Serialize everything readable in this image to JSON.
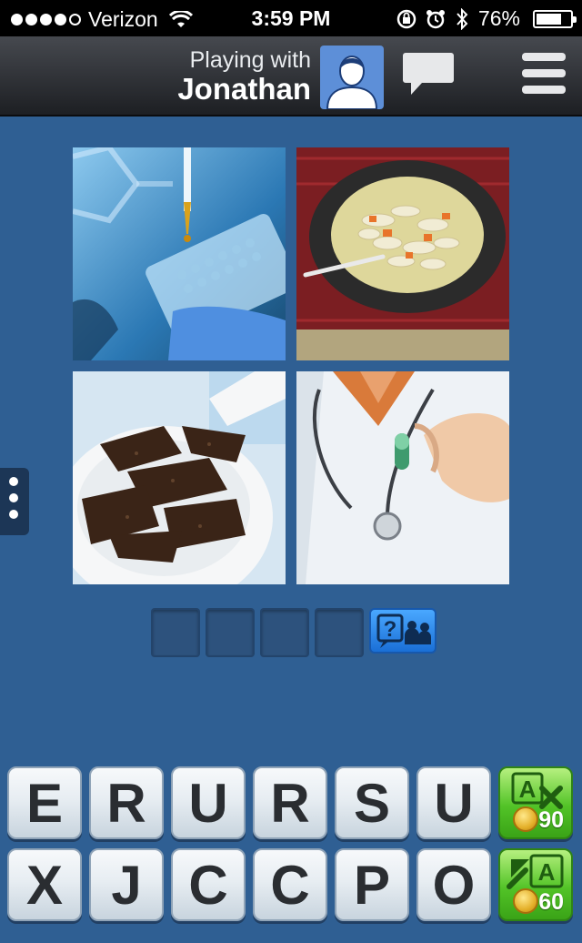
{
  "status_bar": {
    "carrier": "Verizon",
    "time": "3:59 PM",
    "battery": "76%",
    "battery_level": 0.76,
    "signal_bars_filled": 4,
    "signal_bars_total": 5
  },
  "header": {
    "playing_with_label": "Playing with",
    "opponent_name": "Jonathan"
  },
  "puzzle": {
    "images": [
      "pipette-lab-icon",
      "noodle-soup-icon",
      "beef-jerky-icon",
      "doctor-pill-icon"
    ],
    "answer_length": 4
  },
  "keyboard": {
    "row1": [
      "E",
      "R",
      "U",
      "R",
      "S",
      "U"
    ],
    "row2": [
      "X",
      "J",
      "C",
      "C",
      "P",
      "O"
    ],
    "remove_letters_cost": "90",
    "reveal_letter_cost": "60"
  },
  "colors": {
    "background": "#2f5f93",
    "header": "#2b2d31",
    "power_up_green": "#52c327",
    "help_blue": "#2b86f0"
  }
}
